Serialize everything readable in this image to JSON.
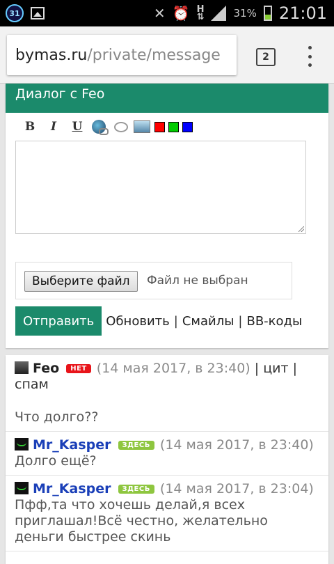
{
  "status_bar": {
    "calendar_badge": "31",
    "h_indicator": "H",
    "battery_percent": "31%",
    "time": "21:01"
  },
  "browser": {
    "url_domain": "bymas.ru",
    "url_path": "/private/message",
    "tab_count": "2"
  },
  "dialog": {
    "title": "Диалог с Feo",
    "toolbar": {
      "bold": "B",
      "italic": "I",
      "underline": "U",
      "colors": [
        "#ff0000",
        "#00cc00",
        "#0000ff"
      ]
    },
    "message_value": "",
    "file_button": "Выберите файл",
    "file_status": "Файл не выбран",
    "send_button": "Отправить",
    "refresh_link": "Обновить",
    "smileys_link": "Смайлы",
    "bbcodes_link": "BB-коды",
    "separator": "|"
  },
  "messages": [
    {
      "user": "Feo",
      "status": "НЕТ",
      "time": "(14 мая 2017, в 23:40)",
      "quote_link": "цит",
      "spam_link": "спам",
      "text": "Что долго??"
    },
    {
      "user": "Mr_Kasper",
      "status": "ЗДЕСЬ",
      "time": "(14 мая 2017, в 23:40)",
      "text": "Долго ещё?"
    },
    {
      "user": "Mr_Kasper",
      "status": "ЗДЕСЬ",
      "time": "(14 мая 2017, в 23:04)",
      "text": "Пфф,та что хочешь делай,я всех приглашал!Всё честно, желательно деньги быстрее скинь"
    }
  ]
}
